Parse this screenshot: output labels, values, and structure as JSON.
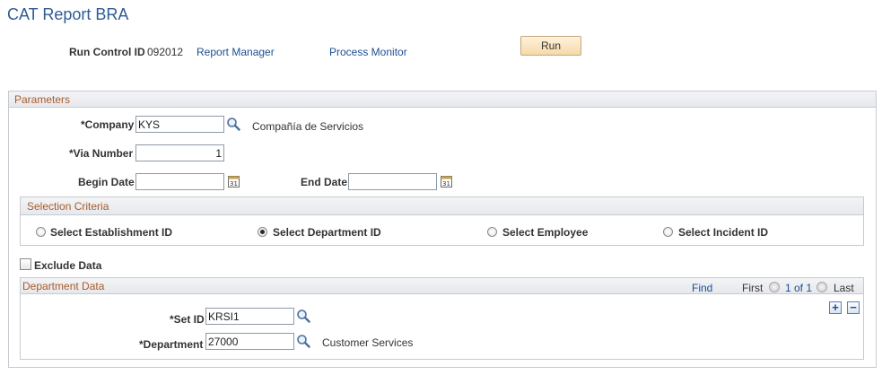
{
  "page": {
    "title": "CAT Report BRA"
  },
  "header": {
    "run_control_label": "Run Control ID",
    "run_control_value": "092012",
    "report_manager_link": "Report Manager",
    "process_monitor_link": "Process Monitor",
    "run_button": "Run"
  },
  "parameters": {
    "title": "Parameters",
    "company_label": "*Company",
    "company_value": "KYS",
    "company_description": "Compañía de Servicios",
    "via_number_label": "*Via Number",
    "via_number_value": "1",
    "begin_date_label": "Begin Date",
    "begin_date_value": "",
    "end_date_label": "End Date",
    "end_date_value": ""
  },
  "selection_criteria": {
    "title": "Selection Criteria",
    "options": [
      {
        "label": "Select Establishment ID",
        "selected": false
      },
      {
        "label": "Select Department ID",
        "selected": true
      },
      {
        "label": "Select Employee",
        "selected": false
      },
      {
        "label": "Select Incident ID",
        "selected": false
      }
    ]
  },
  "exclude_data": {
    "label": "Exclude Data",
    "checked": false
  },
  "department_data": {
    "title": "Department Data",
    "find_link": "Find",
    "first_label": "First",
    "pager_text": "1 of 1",
    "last_label": "Last",
    "set_id_label": "*Set ID",
    "set_id_value": "KRSI1",
    "department_label": "*Department",
    "department_value": "27000",
    "department_description": "Customer Services",
    "add_row": "+",
    "delete_row": "−"
  },
  "colors": {
    "title_blue": "#2f5b96",
    "link_blue": "#1d4f91",
    "section_title_orange": "#a85c2a",
    "run_button_fill": "#f6d9a8"
  }
}
